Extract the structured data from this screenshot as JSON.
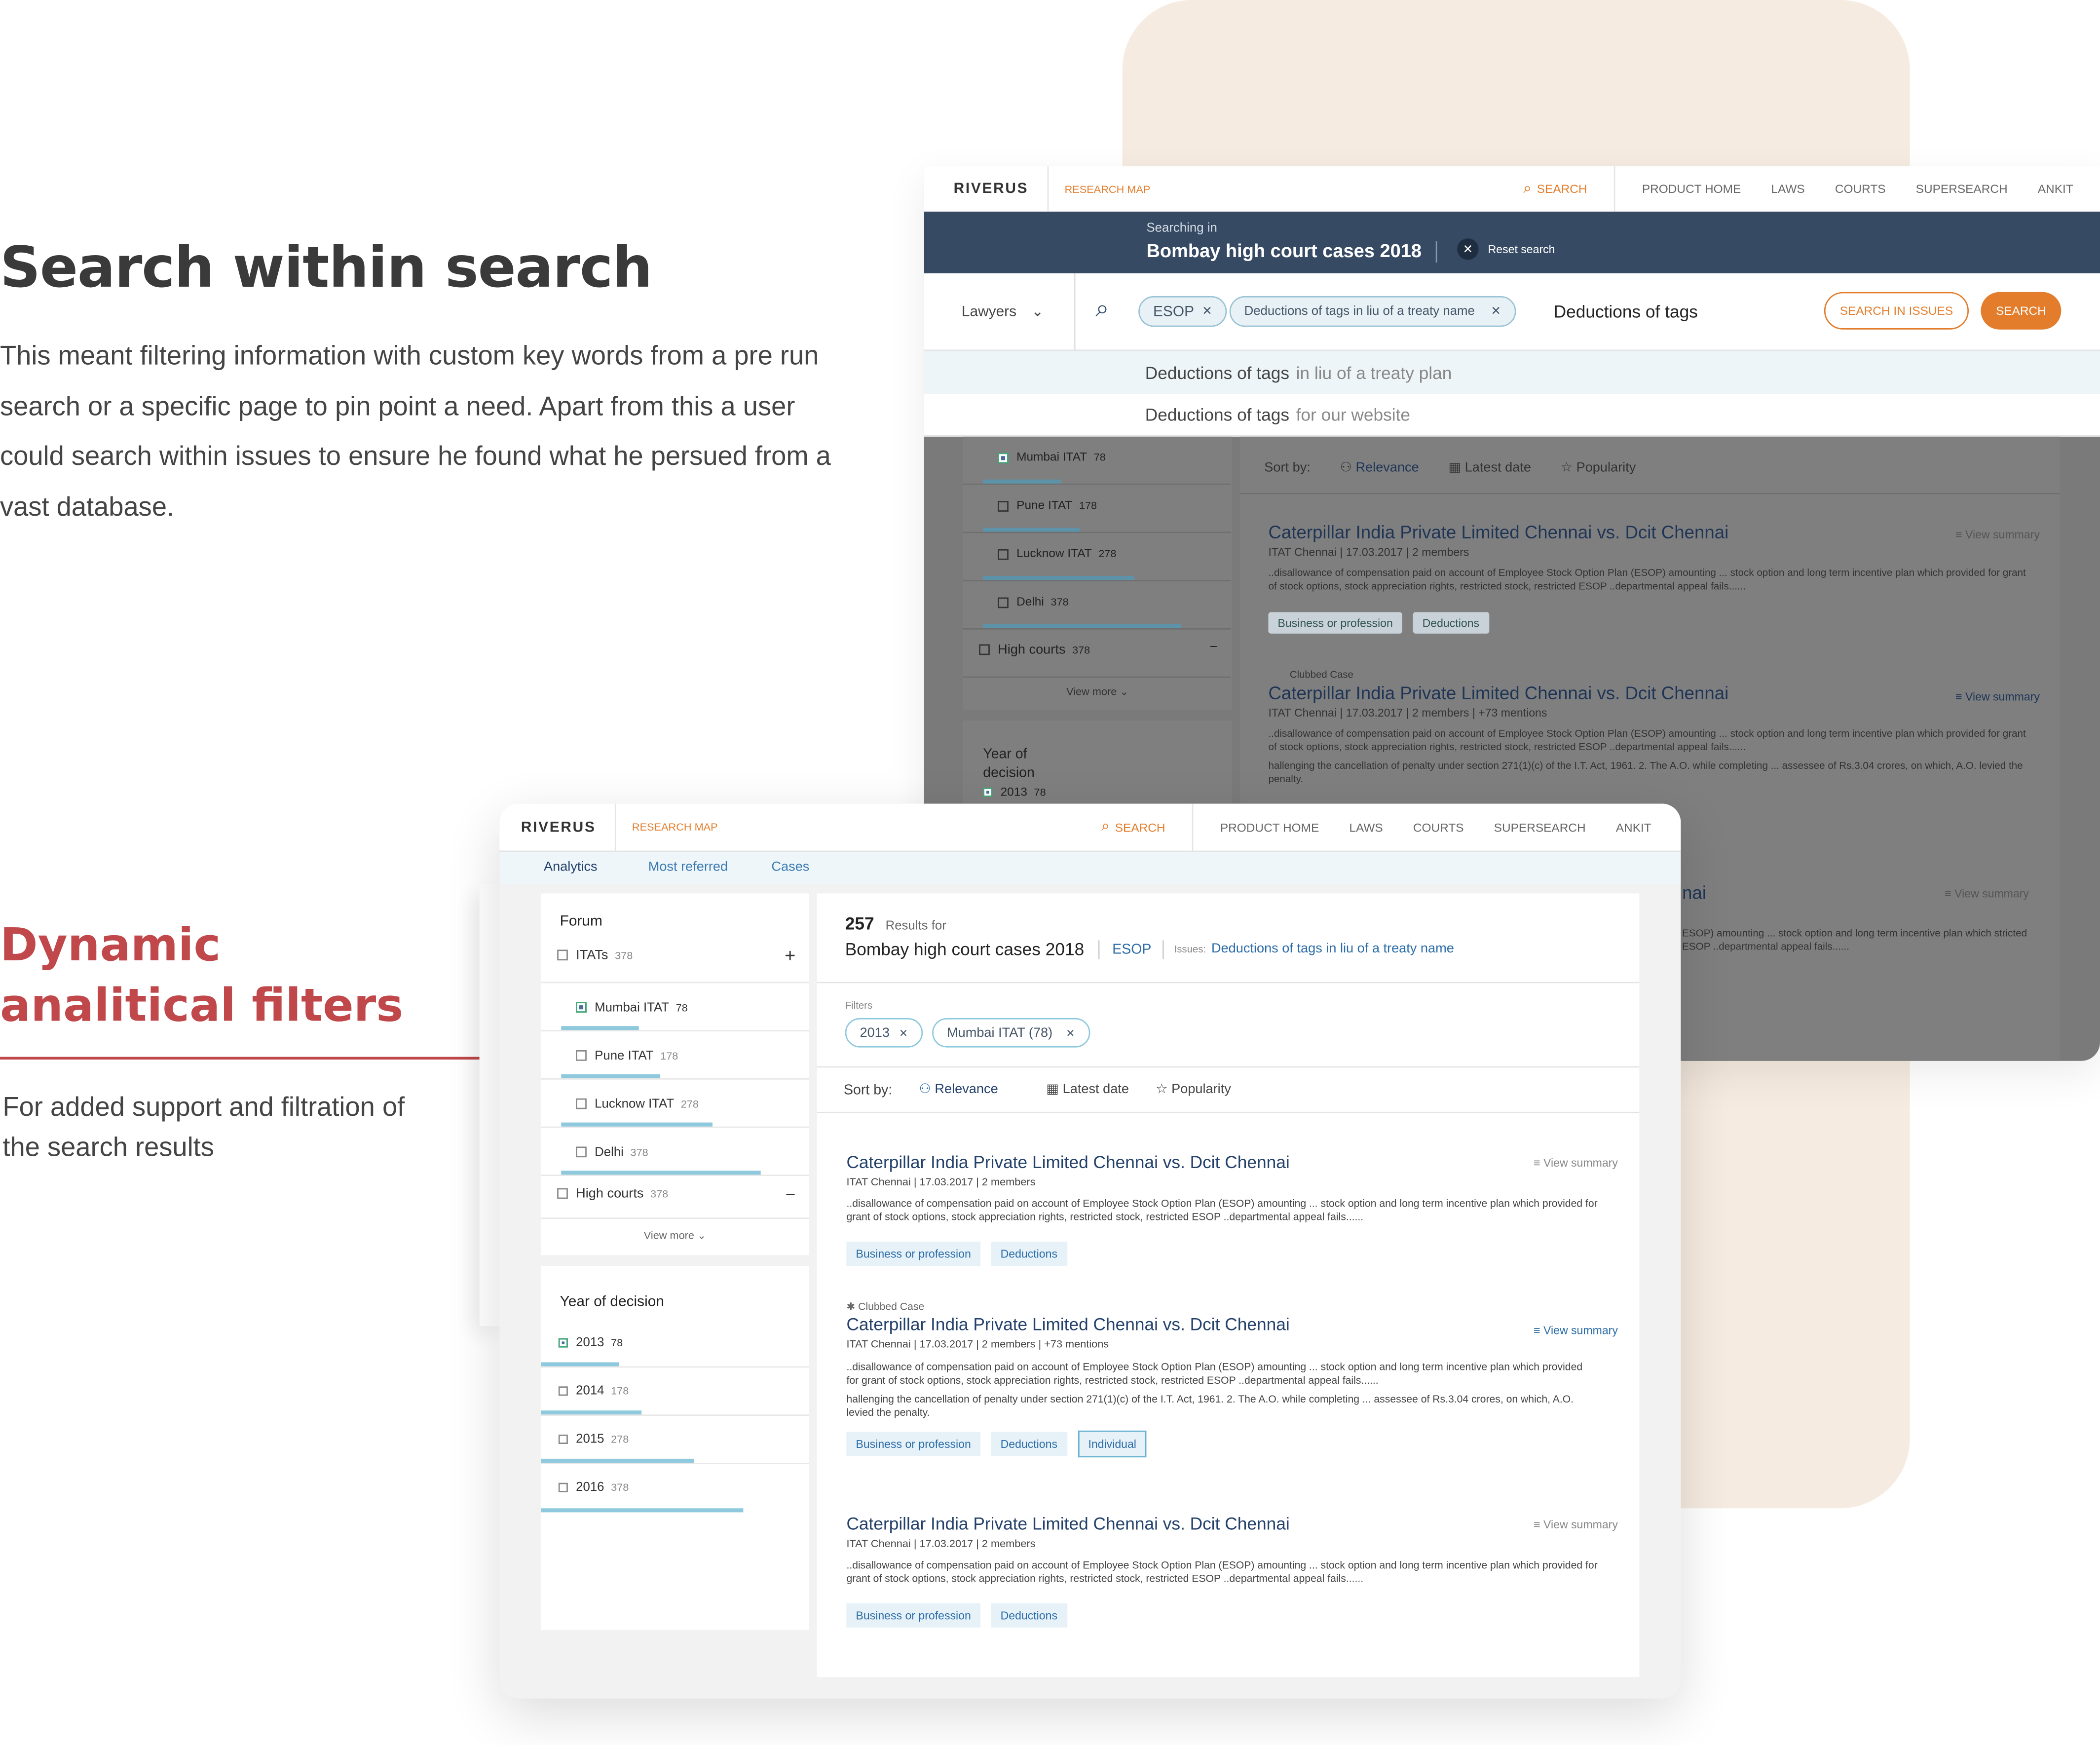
{
  "left": {
    "heading1": "Search within search",
    "para1": "This meant filtering information with custom key words from a pre run search or a specific page to pin point a need. Apart from this a user could search within issues to ensure he found what he persued from a vast database.",
    "heading2": "Dynamic analitical filters",
    "para2": "For added support and filtration of the search results"
  },
  "nav": {
    "logo": "RIVERUS",
    "research_map": "RESEARCH MAP",
    "search": "SEARCH",
    "items": [
      "PRODUCT HOME",
      "LAWS",
      "COURTS",
      "SUPERSEARCH",
      "ANKIT"
    ]
  },
  "back": {
    "searching_in": "Searching in",
    "scope": "Bombay high court cases 2018",
    "reset": "Reset search",
    "lawyers": "Lawyers",
    "chip1": "ESOP",
    "chip2": "Deductions of tags in liu of a treaty name",
    "query": "Deductions of tags",
    "search_in_issues": "SEARCH IN ISSUES",
    "search_btn": "SEARCH",
    "sugg1_bold": "Deductions of tags",
    "sugg1_rest": "in liu of a treaty plan",
    "sugg2_bold": "Deductions of tags",
    "sugg2_rest": "for our website",
    "filters": [
      {
        "label": "Mumbai ITAT",
        "count": "78"
      },
      {
        "label": "Pune ITAT",
        "count": "178"
      },
      {
        "label": "Lucknow ITAT",
        "count": "278"
      },
      {
        "label": "Delhi",
        "count": "378"
      }
    ],
    "high_courts": "High courts",
    "high_courts_count": "378",
    "view_more": "View more",
    "year_label": "Year of decision",
    "year_2013": "2013",
    "year_2013_count": "78",
    "sort_label": "Sort by:",
    "sort_relevance": "Relevance",
    "sort_latest": "Latest date",
    "sort_popularity": "Popularity",
    "r1_title": "Caterpillar India Private Limited Chennai vs. Dcit Chennai",
    "r1_meta": "ITAT Chennai  |  17.03.2017  |  2 members",
    "r1_ex": "..disallowance of compensation paid on account of Employee Stock Option Plan (ESOP) amounting ... stock option and long term incentive plan which provided for grant of stock options, stock appreciation rights, restricted stock, restricted ESOP ..departmental appeal fails......",
    "r2_label": "Clubbed Case",
    "r2_title": "Caterpillar India Private Limited Chennai vs. Dcit Chennai",
    "r2_meta": "ITAT Chennai  |  17.03.2017  |  2 members  |  +73 mentions",
    "r2_ex": "..disallowance of compensation paid on account of Employee Stock Option Plan (ESOP) amounting ... stock option and long term incentive plan which provided for grant of stock options, stock appreciation rights, restricted stock, restricted ESOP ..departmental appeal fails......",
    "r2_ex2": "hallenging the cancellation of penalty under section 271(1)(c) of the I.T. Act, 1961. 2. The A.O. while completing ... assessee of Rs.3.04 crores, on which, A.O. levied the penalty.",
    "r3_title_fragment": "nai",
    "r3_ex": "ESOP) amounting ... stock option and long term incentive plan which stricted ESOP ..departmental appeal fails......",
    "view_summary": "View summary",
    "tag1": "Business or profession",
    "tag2": "Deductions"
  },
  "front": {
    "tabs": [
      "Analytics",
      "Most referred",
      "Cases"
    ],
    "forum": "Forum",
    "itats": "ITATs",
    "itats_count": "378",
    "forum_items": [
      {
        "label": "Mumbai ITAT",
        "count": "78"
      },
      {
        "label": "Pune ITAT",
        "count": "178"
      },
      {
        "label": "Lucknow ITAT",
        "count": "278"
      },
      {
        "label": "Delhi",
        "count": "378"
      }
    ],
    "high_courts": "High courts",
    "high_courts_count": "378",
    "view_more": "View more",
    "year_title": "Year of decision",
    "years": [
      {
        "label": "2013",
        "count": "78"
      },
      {
        "label": "2014",
        "count": "178"
      },
      {
        "label": "2015",
        "count": "278"
      },
      {
        "label": "2016",
        "count": "378"
      }
    ],
    "result_count": "257",
    "results_for": "Results for",
    "scope": "Bombay high court cases 2018",
    "esop": "ESOP",
    "issues_label": "Issues:",
    "issues_value": "Deductions of tags in liu of a treaty name",
    "filters_label": "Filters",
    "filter_chip1": "2013",
    "filter_chip2": "Mumbai ITAT (78)",
    "sort_label": "Sort by:",
    "sort_relevance": "Relevance",
    "sort_latest": "Latest date",
    "sort_popularity": "Popularity",
    "r1_title": "Caterpillar India Private Limited Chennai vs. Dcit Chennai",
    "r1_meta": "ITAT Chennai  |  17.03.2017  |  2 members",
    "r1_ex": "..disallowance of compensation paid on account of Employee Stock Option Plan (ESOP) amounting ... stock option and long term incentive plan which provided for grant of stock options, stock appreciation rights, restricted stock, restricted ESOP ..departmental appeal fails......",
    "r2_label": "Clubbed Case",
    "r2_title": "Caterpillar India Private Limited Chennai vs. Dcit Chennai",
    "r2_meta": "ITAT Chennai  |  17.03.2017  |  2 members  |  +73 mentions",
    "r2_ex": "..disallowance of compensation paid on account of Employee Stock Option Plan (ESOP) amounting ... stock option and long term incentive plan which provided for grant of stock options, stock appreciation rights, restricted stock, restricted ESOP ..departmental appeal fails......",
    "r2_ex2": "hallenging the cancellation of penalty under section 271(1)(c) of the I.T. Act, 1961. 2. The A.O. while completing ... assessee of Rs.3.04 crores, on which, A.O. levied the penalty.",
    "r3_title": "Caterpillar India Private Limited Chennai vs. Dcit Chennai",
    "r3_meta": "ITAT Chennai  |  17.03.2017  |  2 members",
    "r3_ex": "..disallowance of compensation paid on account of Employee Stock Option Plan (ESOP) amounting ... stock option and long term incentive plan which provided for grant of stock options, stock appreciation rights, restricted stock, restricted ESOP ..departmental appeal fails......",
    "view_summary": "View summary",
    "tag1": "Business or profession",
    "tag2": "Deductions",
    "tag3": "Individual"
  },
  "colors": {
    "accent_red": "#c0474a",
    "brand_orange": "#e37d2b",
    "navy": "#364a64",
    "link_blue": "#2b6ca8"
  }
}
